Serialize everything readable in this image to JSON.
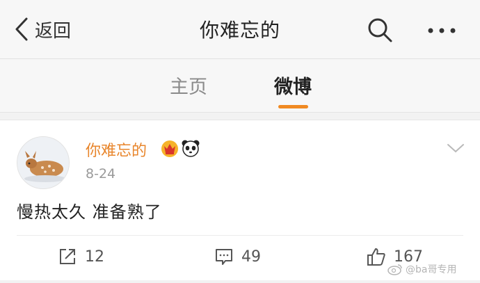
{
  "header": {
    "back_label": "返回",
    "title": "你难忘的",
    "search_icon": "search-icon",
    "more_icon": "more-icon"
  },
  "tabs": [
    {
      "label": "主页",
      "active": false
    },
    {
      "label": "微博",
      "active": true
    }
  ],
  "accent_color": "#f08a22",
  "post": {
    "author": "你难忘的",
    "author_color": "#e8852b",
    "badges": [
      "crown-badge-icon",
      "panda-badge-icon"
    ],
    "date": "8-24",
    "content": "慢热太久 准备熟了",
    "actions": {
      "repost_count": "12",
      "comment_count": "49",
      "like_count": "167"
    }
  },
  "watermark": "@ba哥专用"
}
